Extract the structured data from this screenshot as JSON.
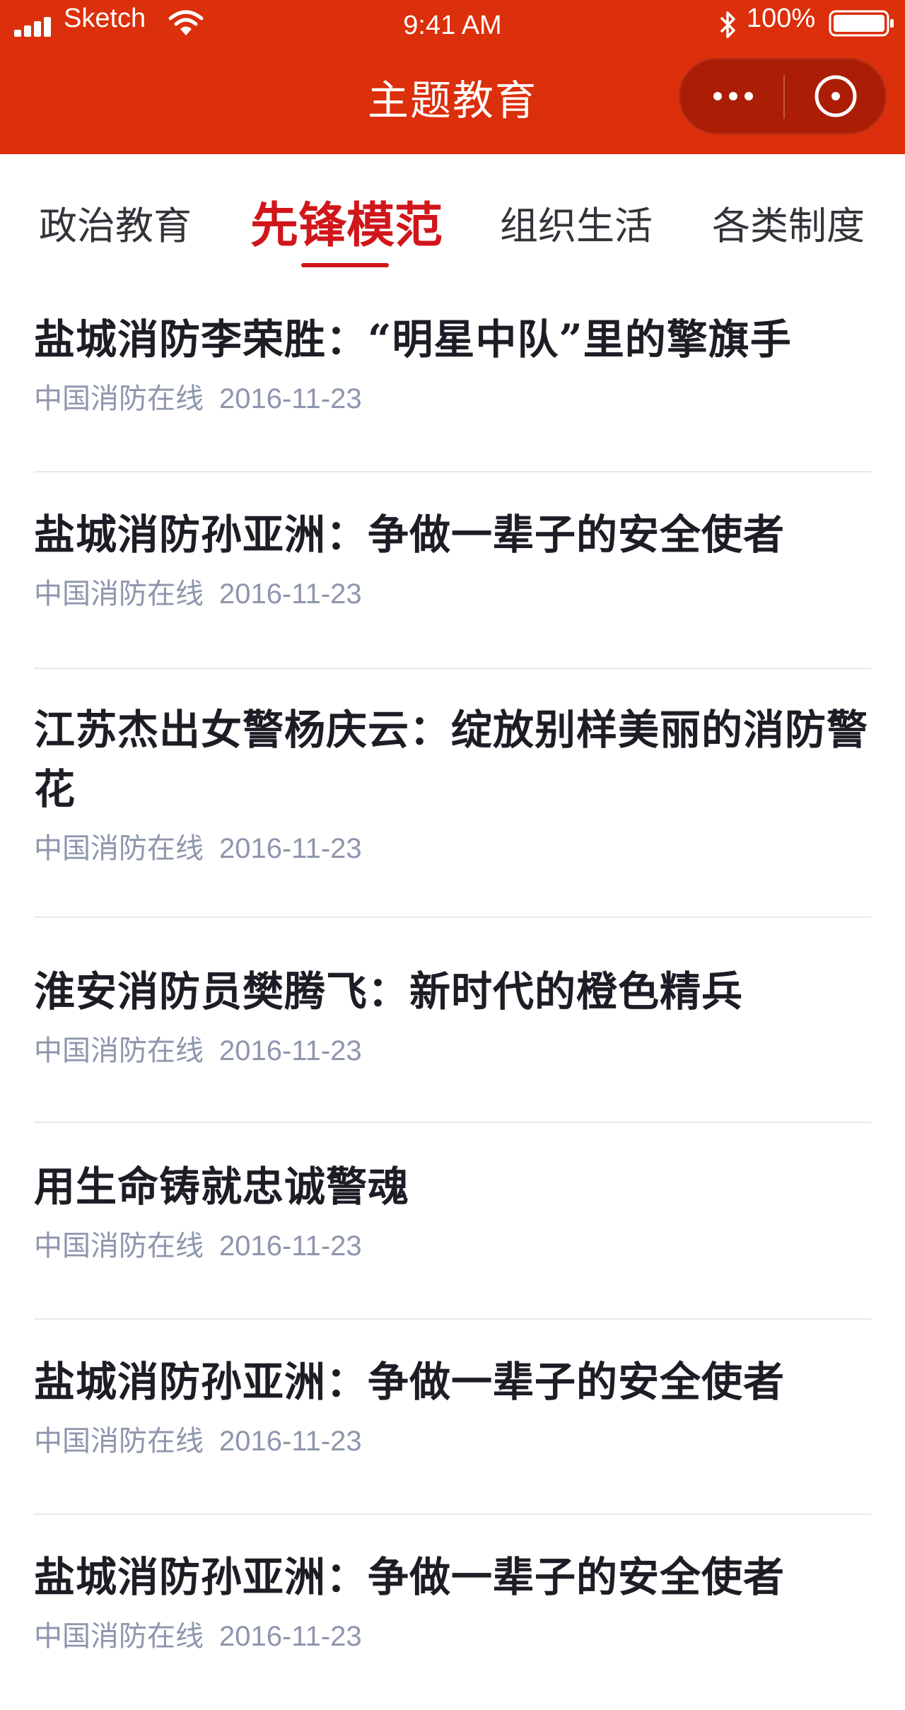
{
  "status_bar": {
    "carrier": "Sketch",
    "time": "9:41 AM",
    "battery": "100%"
  },
  "header": {
    "title": "主题教育",
    "more_icon": "ellipsis-icon",
    "close_icon": "target-close-icon"
  },
  "tabs": [
    {
      "label": "政治教育"
    },
    {
      "label": "先锋模范"
    },
    {
      "label": "组织生活"
    },
    {
      "label": "各类制度"
    }
  ],
  "active_tab": "先锋模范",
  "articles": [
    {
      "title": "盐城消防李荣胜：“明星中队”里的擎旗手",
      "source": "中国消防在线",
      "date": "2016-11-23"
    },
    {
      "title": "盐城消防孙亚洲：争做一辈子的安全使者",
      "source": "中国消防在线",
      "date": "2016-11-23"
    },
    {
      "title": "江苏杰出女警杨庆云：绽放别样美丽的消防警花",
      "source": "中国消防在线",
      "date": "2016-11-23"
    },
    {
      "title": "淮安消防员樊腾飞：新时代的橙色精兵",
      "source": "中国消防在线",
      "date": "2016-11-23"
    },
    {
      "title": "用生命铸就忠诚警魂",
      "source": "中国消防在线",
      "date": "2016-11-23"
    },
    {
      "title": "盐城消防孙亚洲：争做一辈子的安全使者",
      "source": "中国消防在线",
      "date": "2016-11-23"
    },
    {
      "title": "盐城消防孙亚洲：争做一辈子的安全使者",
      "source": "中国消防在线",
      "date": "2016-11-23"
    }
  ],
  "colors": {
    "header_bg": "#dc2f0b",
    "accent": "#d0161b",
    "meta_text": "#8e96ad"
  }
}
